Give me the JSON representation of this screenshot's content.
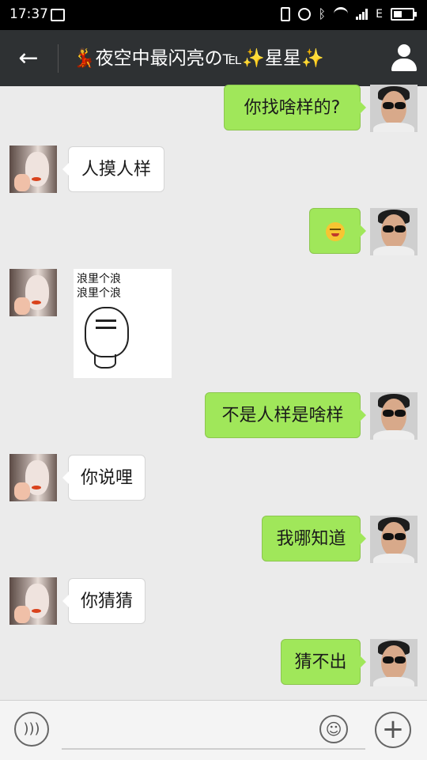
{
  "status": {
    "time": "17:37",
    "network": "E"
  },
  "chat": {
    "title": "💃夜空中最闪亮の℡✨星星✨",
    "back_icon": "arrow-left-icon",
    "profile_icon": "person-icon"
  },
  "messages": [
    {
      "side": "out",
      "type": "text",
      "text": "你找啥样的?"
    },
    {
      "side": "in",
      "type": "text",
      "text": "人摸人样"
    },
    {
      "side": "out",
      "type": "emoji",
      "emoji": "smiling-tongue-emoji"
    },
    {
      "side": "in",
      "type": "sticker",
      "lines": [
        "浪里个浪",
        "浪里个浪"
      ]
    },
    {
      "side": "out",
      "type": "text",
      "text": "不是人样是啥样"
    },
    {
      "side": "in",
      "type": "text",
      "text": "你说哩"
    },
    {
      "side": "out",
      "type": "text",
      "text": "我哪知道"
    },
    {
      "side": "in",
      "type": "text",
      "text": "你猜猜"
    },
    {
      "side": "out",
      "type": "text",
      "text": "猜不出"
    }
  ],
  "input": {
    "value": "",
    "voice_icon": "voice-icon",
    "emoji_icon": "emoji-icon",
    "add_icon": "plus-icon"
  }
}
